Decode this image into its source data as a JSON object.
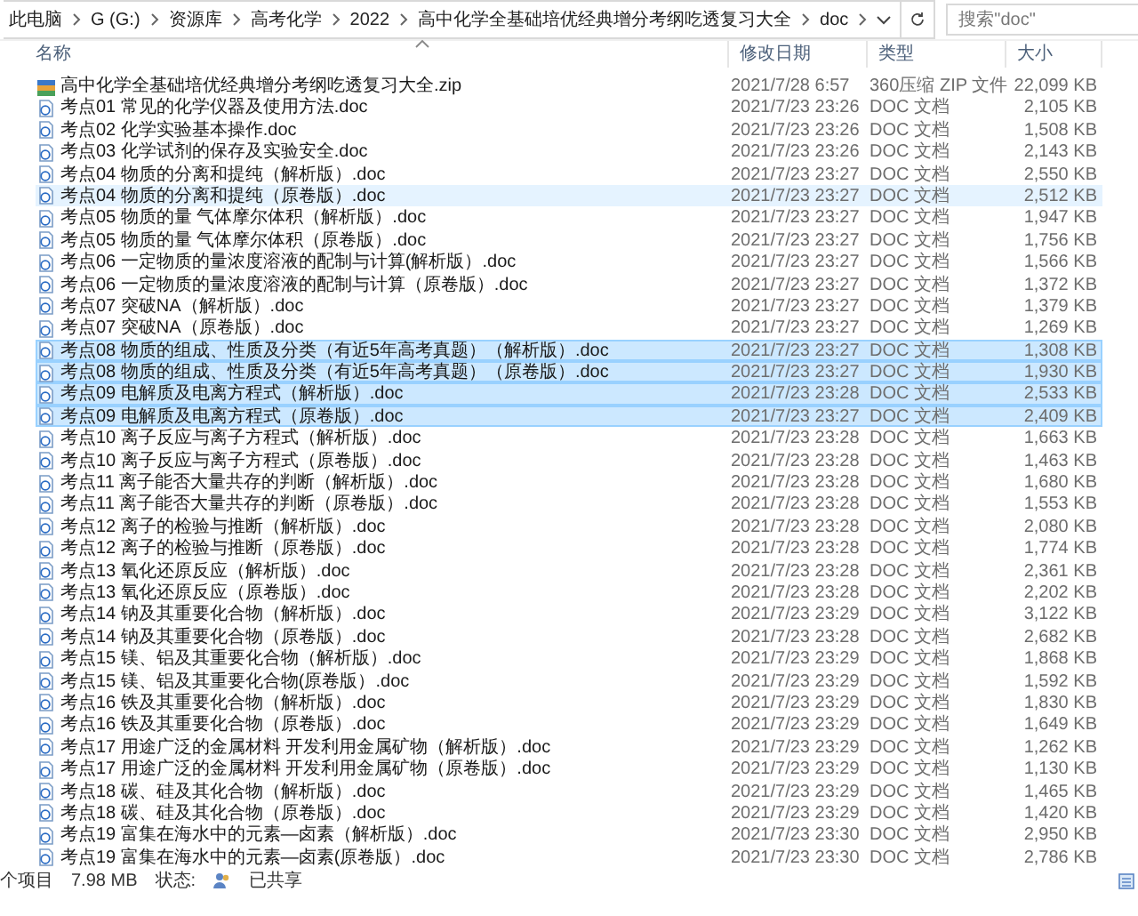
{
  "address_bar": {
    "crumbs": [
      "此电脑",
      "G (G:)",
      "资源库",
      "高考化学",
      "2022",
      "高中化学全基础培优经典增分考纲吃透复习大全",
      "doc"
    ]
  },
  "search": {
    "placeholder": "搜索\"doc\""
  },
  "columns": [
    "名称",
    "修改日期",
    "类型",
    "大小"
  ],
  "files": [
    {
      "kind": "zip",
      "name": "高中化学全基础培优经典增分考纲吃透复习大全.zip",
      "modified": "2021/7/28 6:57",
      "type": "360压缩 ZIP 文件",
      "size": "22,099 KB",
      "selected": false,
      "hovered": false
    },
    {
      "kind": "doc",
      "name": "考点01 常见的化学仪器及使用方法.doc",
      "modified": "2021/7/23 23:26",
      "type": "DOC 文档",
      "size": "2,105 KB",
      "selected": false,
      "hovered": false
    },
    {
      "kind": "doc",
      "name": "考点02 化学实验基本操作.doc",
      "modified": "2021/7/23 23:26",
      "type": "DOC 文档",
      "size": "1,508 KB",
      "selected": false,
      "hovered": false
    },
    {
      "kind": "doc",
      "name": "考点03 化学试剂的保存及实验安全.doc",
      "modified": "2021/7/23 23:26",
      "type": "DOC 文档",
      "size": "2,143 KB",
      "selected": false,
      "hovered": false
    },
    {
      "kind": "doc",
      "name": "考点04 物质的分离和提纯（解析版）.doc",
      "modified": "2021/7/23 23:27",
      "type": "DOC 文档",
      "size": "2,550 KB",
      "selected": false,
      "hovered": false
    },
    {
      "kind": "doc",
      "name": "考点04 物质的分离和提纯（原卷版）.doc",
      "modified": "2021/7/23 23:27",
      "type": "DOC 文档",
      "size": "2,512 KB",
      "selected": false,
      "hovered": true
    },
    {
      "kind": "doc",
      "name": "考点05 物质的量 气体摩尔体积（解析版）.doc",
      "modified": "2021/7/23 23:27",
      "type": "DOC 文档",
      "size": "1,947 KB",
      "selected": false,
      "hovered": false
    },
    {
      "kind": "doc",
      "name": "考点05 物质的量 气体摩尔体积（原卷版）.doc",
      "modified": "2021/7/23 23:27",
      "type": "DOC 文档",
      "size": "1,756 KB",
      "selected": false,
      "hovered": false
    },
    {
      "kind": "doc",
      "name": "考点06 一定物质的量浓度溶液的配制与计算(解析版）.doc",
      "modified": "2021/7/23 23:27",
      "type": "DOC 文档",
      "size": "1,566 KB",
      "selected": false,
      "hovered": false
    },
    {
      "kind": "doc",
      "name": "考点06 一定物质的量浓度溶液的配制与计算（原卷版）.doc",
      "modified": "2021/7/23 23:27",
      "type": "DOC 文档",
      "size": "1,372 KB",
      "selected": false,
      "hovered": false
    },
    {
      "kind": "doc",
      "name": "考点07 突破NA（解析版）.doc",
      "modified": "2021/7/23 23:27",
      "type": "DOC 文档",
      "size": "1,379 KB",
      "selected": false,
      "hovered": false
    },
    {
      "kind": "doc",
      "name": "考点07 突破NA（原卷版）.doc",
      "modified": "2021/7/23 23:27",
      "type": "DOC 文档",
      "size": "1,269 KB",
      "selected": false,
      "hovered": false
    },
    {
      "kind": "doc",
      "name": "考点08 物质的组成、性质及分类（有近5年高考真题）（解析版）.doc",
      "modified": "2021/7/23 23:27",
      "type": "DOC 文档",
      "size": "1,308 KB",
      "selected": true,
      "hovered": false
    },
    {
      "kind": "doc",
      "name": "考点08 物质的组成、性质及分类（有近5年高考真题）（原卷版）.doc",
      "modified": "2021/7/23 23:27",
      "type": "DOC 文档",
      "size": "1,930 KB",
      "selected": true,
      "hovered": false
    },
    {
      "kind": "doc",
      "name": "考点09 电解质及电离方程式（解析版）.doc",
      "modified": "2021/7/23 23:28",
      "type": "DOC 文档",
      "size": "2,533 KB",
      "selected": true,
      "hovered": false
    },
    {
      "kind": "doc",
      "name": "考点09 电解质及电离方程式（原卷版）.doc",
      "modified": "2021/7/23 23:27",
      "type": "DOC 文档",
      "size": "2,409 KB",
      "selected": true,
      "hovered": false
    },
    {
      "kind": "doc",
      "name": "考点10 离子反应与离子方程式（解析版）.doc",
      "modified": "2021/7/23 23:28",
      "type": "DOC 文档",
      "size": "1,663 KB",
      "selected": false,
      "hovered": false
    },
    {
      "kind": "doc",
      "name": "考点10 离子反应与离子方程式（原卷版）.doc",
      "modified": "2021/7/23 23:28",
      "type": "DOC 文档",
      "size": "1,463 KB",
      "selected": false,
      "hovered": false
    },
    {
      "kind": "doc",
      "name": "考点11 离子能否大量共存的判断（解析版）.doc",
      "modified": "2021/7/23 23:28",
      "type": "DOC 文档",
      "size": "1,680 KB",
      "selected": false,
      "hovered": false
    },
    {
      "kind": "doc",
      "name": "考点11 离子能否大量共存的判断（原卷版）.doc",
      "modified": "2021/7/23 23:28",
      "type": "DOC 文档",
      "size": "1,553 KB",
      "selected": false,
      "hovered": false
    },
    {
      "kind": "doc",
      "name": "考点12 离子的检验与推断（解析版）.doc",
      "modified": "2021/7/23 23:28",
      "type": "DOC 文档",
      "size": "2,080 KB",
      "selected": false,
      "hovered": false
    },
    {
      "kind": "doc",
      "name": "考点12 离子的检验与推断（原卷版）.doc",
      "modified": "2021/7/23 23:28",
      "type": "DOC 文档",
      "size": "1,774 KB",
      "selected": false,
      "hovered": false
    },
    {
      "kind": "doc",
      "name": "考点13 氧化还原反应（解析版）.doc",
      "modified": "2021/7/23 23:28",
      "type": "DOC 文档",
      "size": "2,361 KB",
      "selected": false,
      "hovered": false
    },
    {
      "kind": "doc",
      "name": "考点13 氧化还原反应（原卷版）.doc",
      "modified": "2021/7/23 23:28",
      "type": "DOC 文档",
      "size": "2,202 KB",
      "selected": false,
      "hovered": false
    },
    {
      "kind": "doc",
      "name": "考点14 钠及其重要化合物（解析版）.doc",
      "modified": "2021/7/23 23:29",
      "type": "DOC 文档",
      "size": "3,122 KB",
      "selected": false,
      "hovered": false
    },
    {
      "kind": "doc",
      "name": "考点14 钠及其重要化合物（原卷版）.doc",
      "modified": "2021/7/23 23:28",
      "type": "DOC 文档",
      "size": "2,682 KB",
      "selected": false,
      "hovered": false
    },
    {
      "kind": "doc",
      "name": "考点15 镁、铝及其重要化合物（解析版）.doc",
      "modified": "2021/7/23 23:29",
      "type": "DOC 文档",
      "size": "1,868 KB",
      "selected": false,
      "hovered": false
    },
    {
      "kind": "doc",
      "name": "考点15 镁、铝及其重要化合物(原卷版）.doc",
      "modified": "2021/7/23 23:29",
      "type": "DOC 文档",
      "size": "1,592 KB",
      "selected": false,
      "hovered": false
    },
    {
      "kind": "doc",
      "name": "考点16 铁及其重要化合物（解析版）.doc",
      "modified": "2021/7/23 23:29",
      "type": "DOC 文档",
      "size": "1,830 KB",
      "selected": false,
      "hovered": false
    },
    {
      "kind": "doc",
      "name": "考点16 铁及其重要化合物（原卷版）.doc",
      "modified": "2021/7/23 23:29",
      "type": "DOC 文档",
      "size": "1,649 KB",
      "selected": false,
      "hovered": false
    },
    {
      "kind": "doc",
      "name": "考点17 用途广泛的金属材料 开发利用金属矿物（解析版）.doc",
      "modified": "2021/7/23 23:29",
      "type": "DOC 文档",
      "size": "1,262 KB",
      "selected": false,
      "hovered": false
    },
    {
      "kind": "doc",
      "name": "考点17 用途广泛的金属材料 开发利用金属矿物（原卷版）.doc",
      "modified": "2021/7/23 23:29",
      "type": "DOC 文档",
      "size": "1,130 KB",
      "selected": false,
      "hovered": false
    },
    {
      "kind": "doc",
      "name": "考点18 碳、硅及其化合物（解析版）.doc",
      "modified": "2021/7/23 23:29",
      "type": "DOC 文档",
      "size": "1,465 KB",
      "selected": false,
      "hovered": false
    },
    {
      "kind": "doc",
      "name": "考点18 碳、硅及其化合物（原卷版）.doc",
      "modified": "2021/7/23 23:29",
      "type": "DOC 文档",
      "size": "1,420 KB",
      "selected": false,
      "hovered": false
    },
    {
      "kind": "doc",
      "name": "考点19 富集在海水中的元素—卤素（解析版）.doc",
      "modified": "2021/7/23 23:30",
      "type": "DOC 文档",
      "size": "2,950 KB",
      "selected": false,
      "hovered": false
    },
    {
      "kind": "doc",
      "name": "考点19 富集在海水中的元素—卤素(原卷版）.doc",
      "modified": "2021/7/23 23:30",
      "type": "DOC 文档",
      "size": "2,786 KB",
      "selected": false,
      "hovered": false
    }
  ],
  "status_bar": {
    "count": "个项目",
    "size": "7.98 MB",
    "state": "状态:",
    "shared": "已共享"
  }
}
